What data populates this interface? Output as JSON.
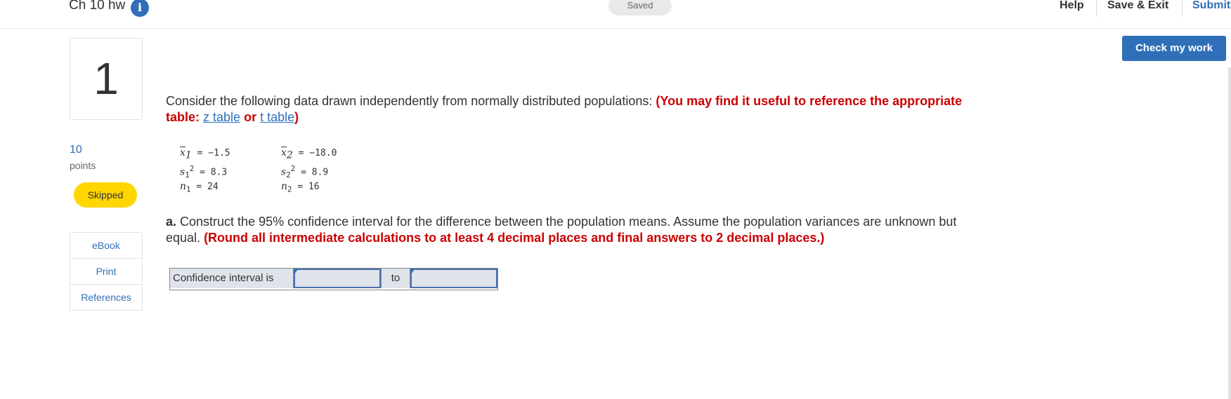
{
  "header": {
    "title": "Ch 10 hw",
    "info_icon": "info-icon",
    "saved_status": "Saved",
    "help_label": "Help",
    "save_exit_label": "Save & Exit",
    "submit_label": "Submit",
    "check_work_label": "Check my work"
  },
  "sidebar": {
    "question_number": "1",
    "points_value": "10",
    "points_label": "points",
    "status_badge": "Skipped",
    "resources": [
      {
        "label": "eBook"
      },
      {
        "label": "Print"
      },
      {
        "label": "References"
      }
    ]
  },
  "question": {
    "intro_text": "Consider the following data drawn independently from normally distributed populations:",
    "note_prefix": "(You may find it useful to reference the appropriate table:",
    "z_table_link": "z table",
    "or_text": "or",
    "t_table_link": "t table",
    "note_suffix": ")",
    "data": {
      "pop1": {
        "xbar_var": "x",
        "xbar_sub": "1",
        "xbar_val": "= −1.5",
        "s_var": "s",
        "s_sub": "1",
        "s_sup": "2",
        "s_val": "= 8.3",
        "n_var": "n",
        "n_sub": "1",
        "n_val": "= 24"
      },
      "pop2": {
        "xbar_var": "x",
        "xbar_sub": "2",
        "xbar_val": "= −18.0",
        "s_var": "s",
        "s_sub": "2",
        "s_sup": "2",
        "s_val": "= 8.9",
        "n_var": "n",
        "n_sub": "2",
        "n_val": "= 16"
      }
    },
    "part_a_label": "a.",
    "part_a_text": "Construct the 95% confidence interval for the difference between the population means. Assume the population variances are unknown but equal.",
    "part_a_note": "(Round all intermediate calculations to at least 4 decimal places and final answers to 2 decimal places.)",
    "ci_label": "Confidence interval is",
    "ci_to": "to",
    "ci_lower_value": "",
    "ci_upper_value": ""
  }
}
